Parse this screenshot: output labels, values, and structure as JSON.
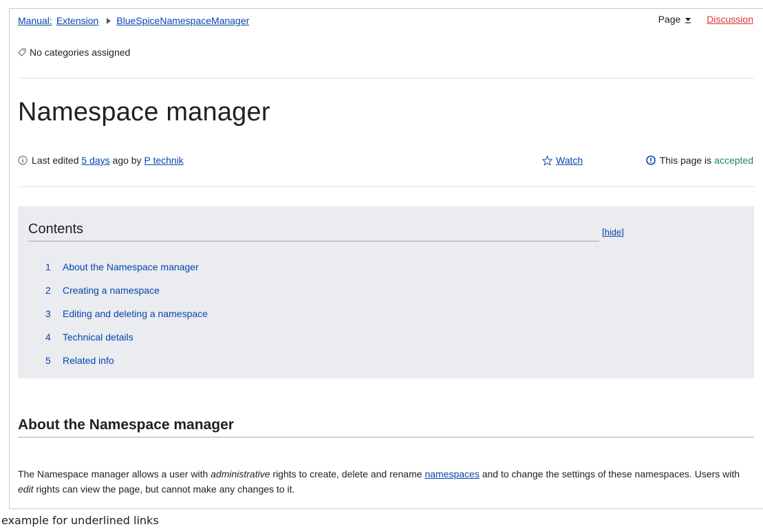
{
  "breadcrumb": {
    "items": [
      "Manual:",
      "Extension",
      "BlueSpiceNamespaceManager"
    ],
    "separator_icon": "triangle-right-icon"
  },
  "page_menu": {
    "page_label": "Page",
    "caret_icon": "caret-down-icon",
    "discussion_label": "Discussion"
  },
  "categories": {
    "icon": "tag-icon",
    "text": "No categories assigned"
  },
  "title": "Namespace manager",
  "meta": {
    "info_icon": "info-circle-icon",
    "edited_prefix": "Last edited",
    "edited_when": "5 days",
    "edited_mid": "ago by",
    "edited_by": "P technik",
    "watch_icon": "star-outline-icon",
    "watch_label": "Watch",
    "status_icon": "alert-circle-icon",
    "status_prefix": "This page is",
    "status_value": "accepted"
  },
  "toc": {
    "title": "Contents",
    "hide_label": "[hide]",
    "items": [
      {
        "num": "1",
        "label": "About the Namespace manager"
      },
      {
        "num": "2",
        "label": "Creating a namespace"
      },
      {
        "num": "3",
        "label": "Editing and deleting a namespace"
      },
      {
        "num": "4",
        "label": "Technical details"
      },
      {
        "num": "5",
        "label": "Related info"
      }
    ]
  },
  "section": {
    "heading": "About the Namespace manager",
    "p1": "The Namespace manager allows a user with ",
    "p1_em": "administrative",
    "p2": " rights to create, delete and rename ",
    "p2_link": "namespaces",
    "p3": " and to change the settings of these namespaces. Users with ",
    "p3_em": "edit",
    "p4": " rights can view the page, but cannot make any changes to it."
  },
  "caption": "example for underlined links",
  "colors": {
    "link": "#0645ad",
    "discussion": "#d33333",
    "accepted": "#14866d",
    "toc_bg": "#eaecf0"
  }
}
